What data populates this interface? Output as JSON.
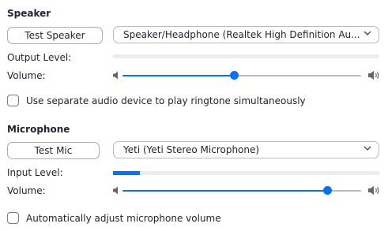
{
  "accent": "#0e71eb",
  "speaker": {
    "title": "Speaker",
    "test_button": "Test Speaker",
    "device": "Speaker/Headphone (Realtek High Definition Au...",
    "output_level_label": "Output Level:",
    "output_level": 0,
    "volume_label": "Volume:",
    "volume": 0.47,
    "separate_device_label": "Use separate audio device to play ringtone simultaneously",
    "separate_device_checked": false
  },
  "microphone": {
    "title": "Microphone",
    "test_button": "Test Mic",
    "device": "Yeti (Yeti Stereo Microphone)",
    "input_level_label": "Input Level:",
    "input_level": 0.1,
    "volume_label": "Volume:",
    "volume": 0.86,
    "auto_adjust_label": "Automatically adjust microphone volume",
    "auto_adjust_checked": false
  },
  "icons": {
    "volume_low": "speaker-low-icon",
    "volume_high": "speaker-high-icon",
    "dropdown": "chevron-down-icon"
  }
}
